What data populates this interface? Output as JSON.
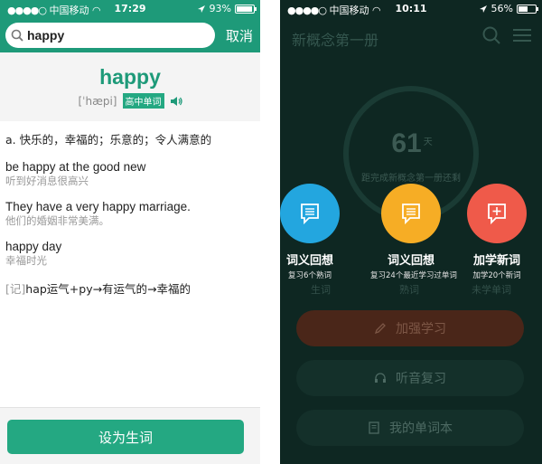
{
  "left": {
    "status": {
      "carrier": "中国移动",
      "time": "17:29",
      "battery": "93%",
      "battery_level": 0.93
    },
    "search": {
      "value": "happy",
      "cancel": "取消"
    },
    "word": {
      "headword": "happy",
      "phonetic": "[ˈhæpi]",
      "level_tag": "高中单词"
    },
    "definition": "a. 快乐的，幸福的；乐意的；令人满意的",
    "examples": [
      {
        "en": "be happy at the good new",
        "cn": "听到好消息很高兴"
      },
      {
        "en": "They have a very happy marriage.",
        "cn": "他们的婚姻非常美满。"
      },
      {
        "en": "happy day",
        "cn": "幸福时光"
      }
    ],
    "mnemonic": {
      "tag": "[记]",
      "text": "hap运气+py→有运气的→幸福的"
    },
    "button": "设为生词",
    "colors": {
      "brand": "#1e9a79",
      "button": "#24a882"
    }
  },
  "right": {
    "status": {
      "carrier": "中国移动",
      "time": "10:11",
      "battery": "56%",
      "battery_level": 0.56
    },
    "title": "新概念第一册",
    "days": "61",
    "days_unit": "天",
    "caption": "距完成新概念第一册还剩",
    "stat_labels": [
      "生词",
      "熟词",
      "未学单词"
    ],
    "circles": [
      {
        "title": "词义回想",
        "subtitle": "复习6个熟词",
        "color": "#23a6df",
        "icon": "card-icon"
      },
      {
        "title": "词义回想",
        "subtitle": "复习24个最近学习过单词",
        "color": "#f6ad25",
        "icon": "card-icon"
      },
      {
        "title": "加学新词",
        "subtitle": "加学20个新词",
        "color": "#ef5a4a",
        "icon": "plus-card-icon"
      }
    ],
    "buttons": [
      "加强学习",
      "听音复习",
      "我的单词本"
    ]
  }
}
